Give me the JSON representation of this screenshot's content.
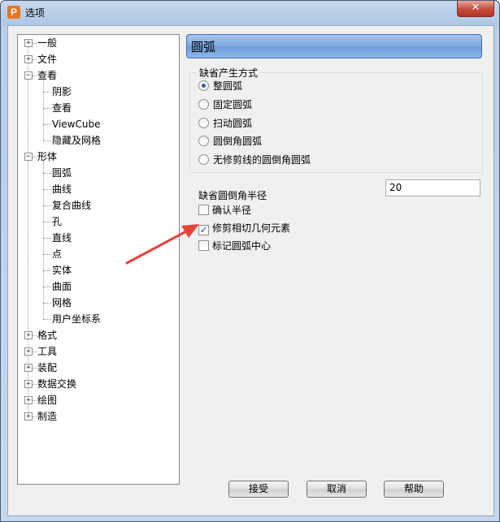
{
  "window": {
    "title": "选项",
    "app_icon_letter": "P",
    "close_symbol": "✕"
  },
  "tree": {
    "items": [
      {
        "label": "一般",
        "expander": "+"
      },
      {
        "label": "文件",
        "expander": "+"
      },
      {
        "label": "查看",
        "expander": "−"
      },
      {
        "label": "阴影"
      },
      {
        "label": "查看"
      },
      {
        "label": "ViewCube"
      },
      {
        "label": "隐藏及网格"
      },
      {
        "label": "形体",
        "expander": "−"
      },
      {
        "label": "圆弧"
      },
      {
        "label": "曲线"
      },
      {
        "label": "复合曲线"
      },
      {
        "label": "孔"
      },
      {
        "label": "直线"
      },
      {
        "label": "点"
      },
      {
        "label": "实体"
      },
      {
        "label": "曲面"
      },
      {
        "label": "网格"
      },
      {
        "label": "用户坐标系"
      },
      {
        "label": "格式",
        "expander": "+"
      },
      {
        "label": "工具",
        "expander": "+"
      },
      {
        "label": "装配",
        "expander": "+"
      },
      {
        "label": "数据交换",
        "expander": "+"
      },
      {
        "label": "绘图",
        "expander": "+"
      },
      {
        "label": "制造",
        "expander": "+"
      }
    ]
  },
  "panel": {
    "title": "圆弧",
    "group_label": "缺省产生方式",
    "radios": [
      {
        "label": "整圆弧",
        "selected": true
      },
      {
        "label": "固定圆弧",
        "selected": false
      },
      {
        "label": "扫动圆弧",
        "selected": false
      },
      {
        "label": "圆倒角圆弧",
        "selected": false
      },
      {
        "label": "无修剪线的圆倒角圆弧",
        "selected": false
      }
    ],
    "radius_label": "缺省圆倒角半径",
    "radius_value": "20",
    "checks": [
      {
        "label": "确认半径",
        "checked": false
      },
      {
        "label": "修剪相切几何元素",
        "checked": true
      },
      {
        "label": "标记圆弧中心",
        "checked": false
      }
    ]
  },
  "buttons": {
    "ok": "接受",
    "cancel": "取消",
    "help": "帮助"
  },
  "colors": {
    "accent_arrow": "#e8453a",
    "header_blue": "#7aa7e0",
    "check_mark": "#1f3f8a"
  }
}
